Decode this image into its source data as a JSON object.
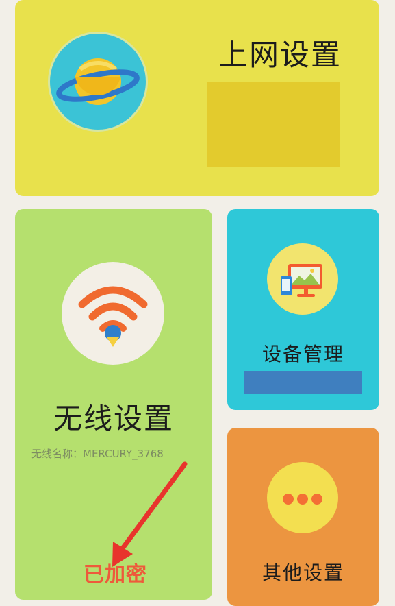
{
  "tiles": {
    "internet": {
      "title": "上网设置"
    },
    "wireless": {
      "title": "无线设置",
      "ssid_label": "无线名称：MERCURY_3768",
      "status": "已加密"
    },
    "devices": {
      "title": "设备管理"
    },
    "other": {
      "title": "其他设置"
    }
  },
  "icons": {
    "internet": "planet-icon",
    "wireless": "wifi-icon",
    "devices": "devices-icon",
    "other": "more-icon",
    "annotation": "red-arrow"
  },
  "colors": {
    "internet_tile": "#e8e14c",
    "wireless_tile": "#b5e06e",
    "devices_tile": "#2ec8d8",
    "other_tile": "#ec9540",
    "encrypted_text": "#ee5a3b",
    "arrow": "#e8342c"
  }
}
